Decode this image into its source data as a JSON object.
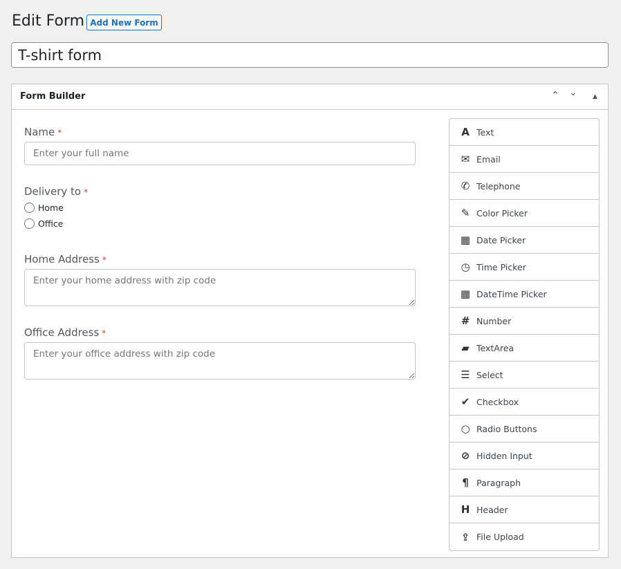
{
  "page": {
    "title": "Edit Form",
    "add_new_label": "Add New Form",
    "form_name": "T-shirt form"
  },
  "panel": {
    "title": "Form Builder",
    "controls": {
      "up": "⌃",
      "down": "⌄",
      "toggle": "▲"
    }
  },
  "fields": {
    "name": {
      "label": "Name",
      "required": "*",
      "placeholder": "Enter your full name"
    },
    "delivery": {
      "label": "Delivery to",
      "required": "*",
      "options": [
        "Home",
        "Office"
      ]
    },
    "home": {
      "label": "Home Address",
      "required": "*",
      "placeholder": "Enter your home address with zip code"
    },
    "office": {
      "label": "Office Address",
      "required": "*",
      "placeholder": "Enter your office address with zip code"
    }
  },
  "palette": [
    {
      "label": "Text",
      "icon": "text-icon",
      "glyph": "A"
    },
    {
      "label": "Email",
      "icon": "envelope-icon",
      "glyph": "✉"
    },
    {
      "label": "Telephone",
      "icon": "phone-icon",
      "glyph": "✆"
    },
    {
      "label": "Color Picker",
      "icon": "eyedropper-icon",
      "glyph": "✎"
    },
    {
      "label": "Date Picker",
      "icon": "calendar-icon",
      "glyph": "▦"
    },
    {
      "label": "Time Picker",
      "icon": "clock-icon",
      "glyph": "◷"
    },
    {
      "label": "DateTime Picker",
      "icon": "calendar-icon",
      "glyph": "▦"
    },
    {
      "label": "Number",
      "icon": "hash-icon",
      "glyph": "#"
    },
    {
      "label": "TextArea",
      "icon": "comment-icon",
      "glyph": "▰"
    },
    {
      "label": "Select",
      "icon": "list-icon",
      "glyph": "☰"
    },
    {
      "label": "Checkbox",
      "icon": "check-circle-icon",
      "glyph": "✔"
    },
    {
      "label": "Radio Buttons",
      "icon": "circle-icon",
      "glyph": "○"
    },
    {
      "label": "Hidden Input",
      "icon": "eye-slash-icon",
      "glyph": "⊘"
    },
    {
      "label": "Paragraph",
      "icon": "paragraph-icon",
      "glyph": "¶"
    },
    {
      "label": "Header",
      "icon": "header-icon",
      "glyph": "H"
    },
    {
      "label": "File Upload",
      "icon": "upload-icon",
      "glyph": "⇪"
    }
  ]
}
